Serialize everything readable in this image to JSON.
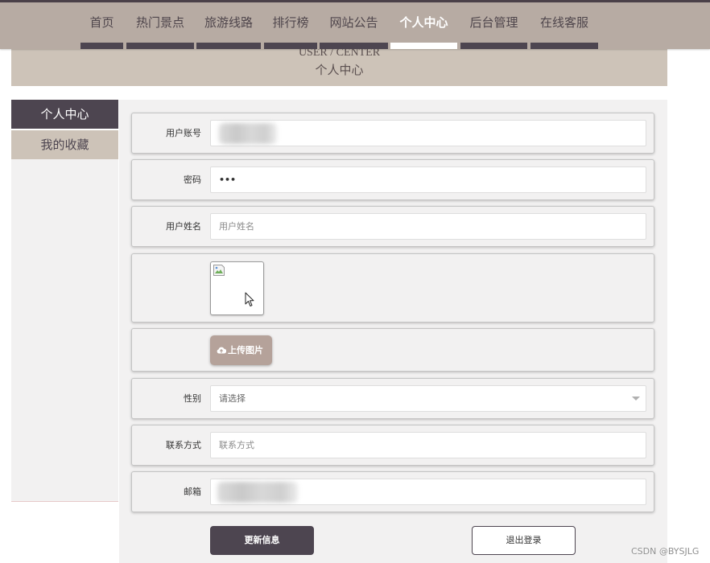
{
  "nav": {
    "items": [
      {
        "label": "首页",
        "active": false
      },
      {
        "label": "热门景点",
        "active": false
      },
      {
        "label": "旅游线路",
        "active": false
      },
      {
        "label": "排行榜",
        "active": false
      },
      {
        "label": "网站公告",
        "active": false
      },
      {
        "label": "个人中心",
        "active": true
      },
      {
        "label": "后台管理",
        "active": false
      },
      {
        "label": "在线客服",
        "active": false
      }
    ]
  },
  "banner": {
    "en_title": "USER / CENTER",
    "title": "个人中心"
  },
  "sidebar": {
    "items": [
      {
        "label": "个人中心",
        "active": true
      },
      {
        "label": "我的收藏",
        "active": false
      }
    ]
  },
  "form": {
    "account": {
      "label": "用户账号"
    },
    "password": {
      "label": "密码",
      "value": "•••"
    },
    "name": {
      "label": "用户姓名",
      "placeholder": "用户姓名"
    },
    "avatar": {
      "icon": "broken-image-icon"
    },
    "upload": {
      "label": "上传图片",
      "icon": "cloud-upload-icon"
    },
    "gender": {
      "label": "性别",
      "placeholder": "请选择",
      "icon": "chevron-down-icon"
    },
    "phone": {
      "label": "联系方式",
      "placeholder": "联系方式"
    },
    "email": {
      "label": "邮箱"
    }
  },
  "actions": {
    "update": "更新信息",
    "logout": "退出登录"
  },
  "watermark": "CSDN @BYSJLG",
  "colors": {
    "nav_bg": "#b7aba3",
    "dark_accent": "#4d4550",
    "tan": "#cdc3b8",
    "panel_bg": "#f2f1f1",
    "upload_button": "#b5a29a"
  }
}
